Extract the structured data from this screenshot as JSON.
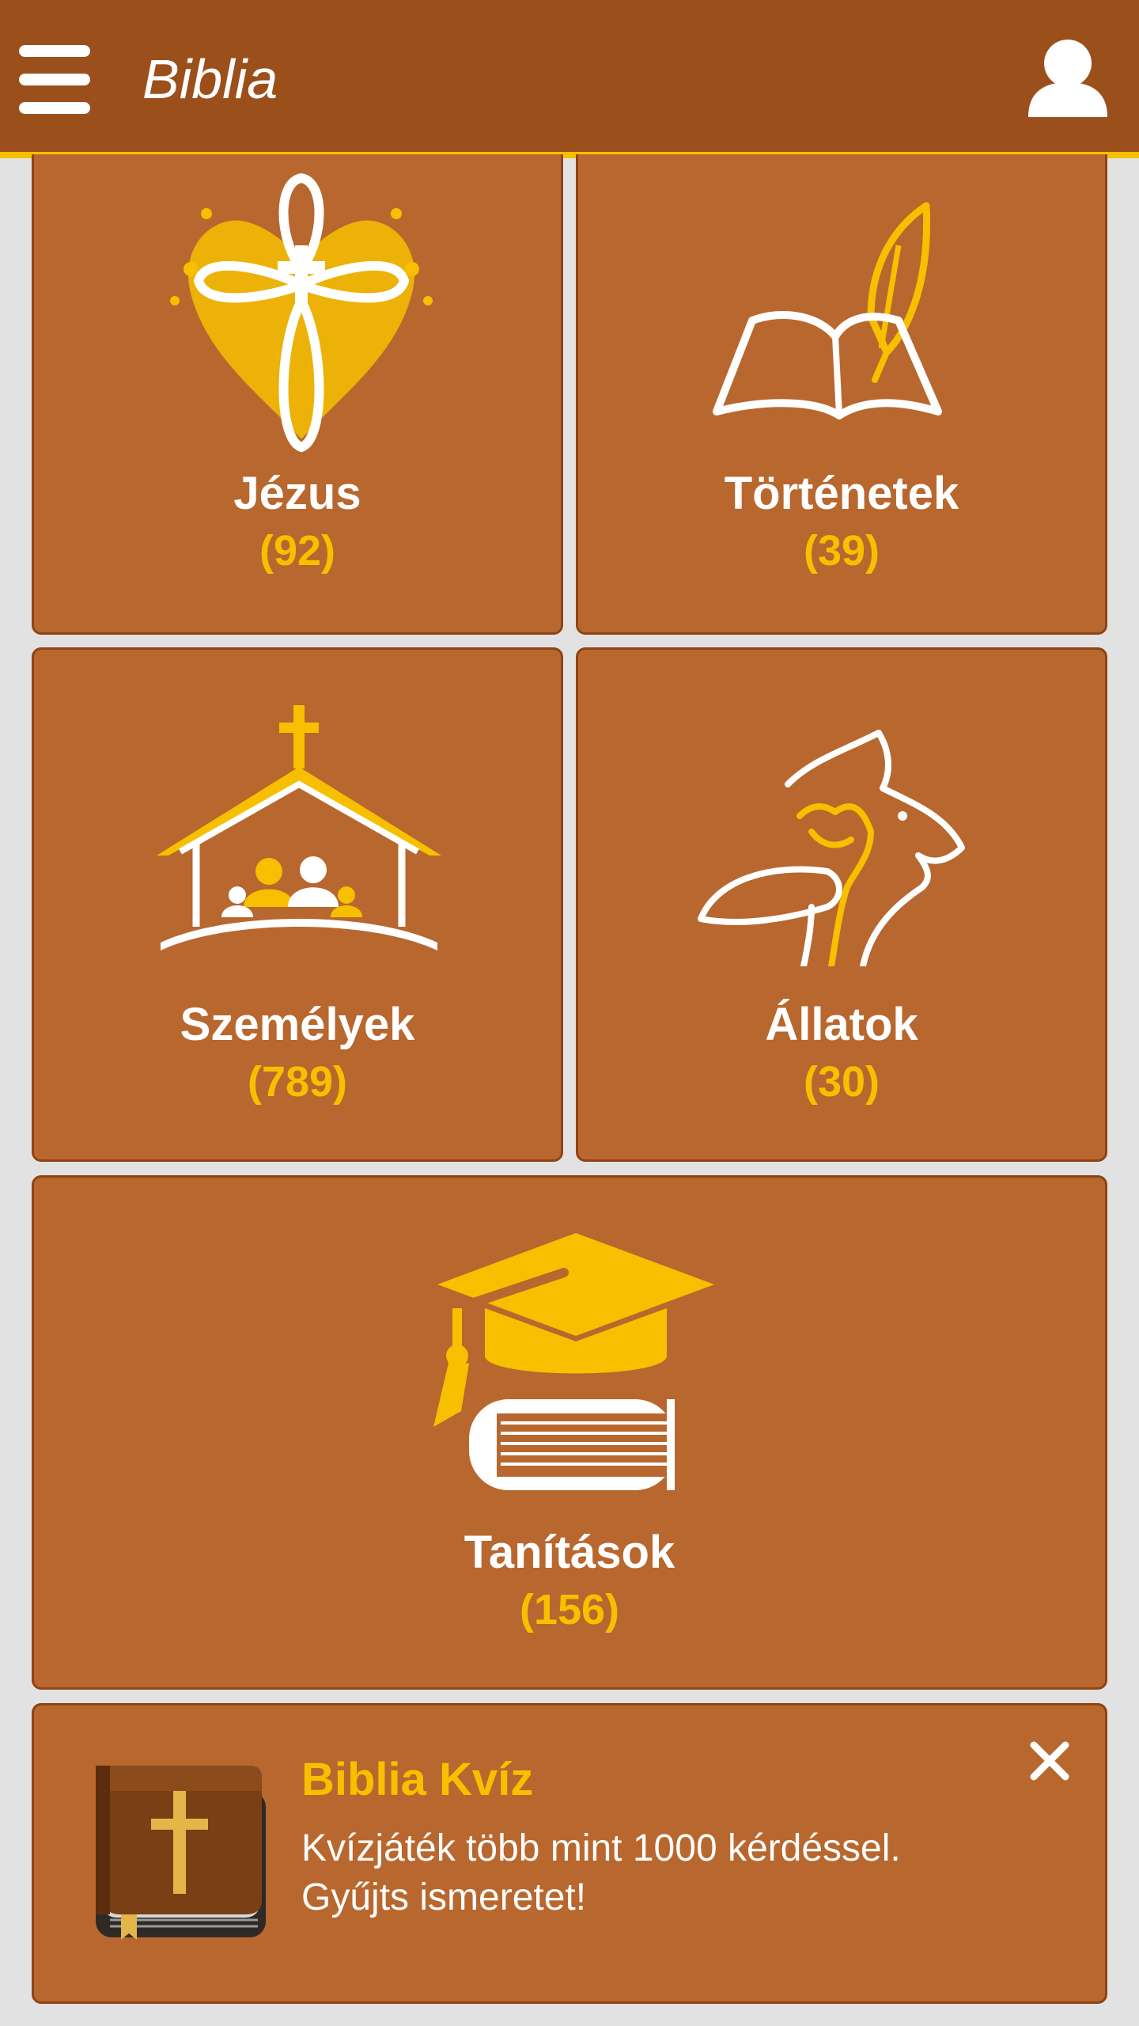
{
  "app": {
    "title": "Biblia"
  },
  "colors": {
    "app_bar": "#9b501c",
    "accent": "#f6c000",
    "tile": "#b8672e",
    "background": "#e2e2e2"
  },
  "categories": [
    {
      "label": "Jézus",
      "count": "(92)",
      "icon": "cross-heart-icon"
    },
    {
      "label": "Történetek",
      "count": "(39)",
      "icon": "open-book-quill-icon"
    },
    {
      "label": "Személyek",
      "count": "(789)",
      "icon": "church-people-icon"
    },
    {
      "label": "Állatok",
      "count": "(30)",
      "icon": "animals-icon"
    },
    {
      "label": "Tanítások",
      "count": "(156)",
      "icon": "graduation-cap-books-icon"
    }
  ],
  "promo": {
    "title": "Biblia Kvíz",
    "description_line1": "Kvízjáték több mint 1000 kérdéssel.",
    "description_line2": "Gyűjts ismeretet!",
    "icon": "bible-book-icon"
  }
}
